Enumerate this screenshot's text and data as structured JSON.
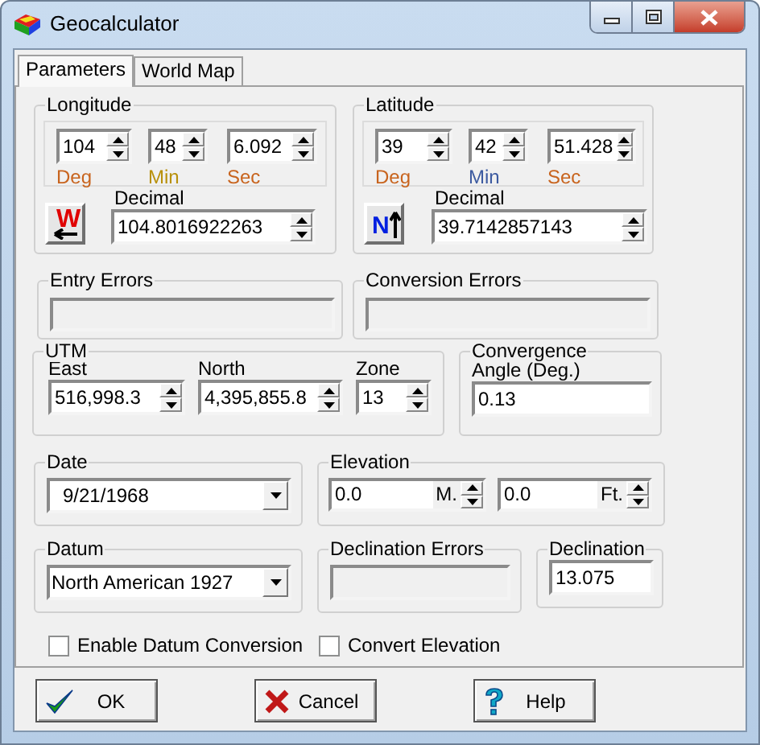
{
  "window": {
    "title": "Geocalculator"
  },
  "tabs": [
    {
      "label": "Parameters",
      "selected": true
    },
    {
      "label": "World Map",
      "selected": false
    }
  ],
  "longitude": {
    "label": "Longitude",
    "fields": [
      {
        "label": "Deg",
        "value": "104"
      },
      {
        "label": "Min",
        "value": "48"
      },
      {
        "label": "Sec",
        "value": "6.092"
      }
    ],
    "hemisphere": "W",
    "decimal_label": "Decimal",
    "decimal": "104.8016922263"
  },
  "latitude": {
    "label": "Latitude",
    "fields": [
      {
        "label": "Deg",
        "value": "39"
      },
      {
        "label": "Min",
        "value": "42"
      },
      {
        "label": "Sec",
        "value": "51.428"
      }
    ],
    "hemisphere": "N",
    "decimal_label": "Decimal",
    "decimal": "39.7142857143"
  },
  "entry_errors": {
    "label": "Entry Errors"
  },
  "conversion_errors": {
    "label": "Conversion Errors"
  },
  "utm": {
    "label": "UTM",
    "fields": [
      {
        "label": "East",
        "value": "516,998.3"
      },
      {
        "label": "North",
        "value": "4,395,855.8"
      },
      {
        "label": "Zone",
        "value": "13"
      }
    ]
  },
  "convergence": {
    "label": "Convergence",
    "sublabel": "Angle (Deg.)",
    "value": "0.13"
  },
  "date": {
    "label": "Date",
    "value": "9/21/1968"
  },
  "elevation": {
    "label": "Elevation",
    "fields": [
      {
        "value": "0.0",
        "unit": "M."
      },
      {
        "value": "0.0",
        "unit": "Ft."
      }
    ]
  },
  "datum": {
    "label": "Datum",
    "value": "North American 1927"
  },
  "declination_errors": {
    "label": "Declination Errors"
  },
  "declination": {
    "label": "Declination",
    "value": "13.075"
  },
  "checkboxes": [
    {
      "label": "Enable Datum Conversion",
      "checked": false
    },
    {
      "label": "Convert Elevation",
      "checked": false
    }
  ],
  "buttons": [
    {
      "label": "OK",
      "kind": "ok"
    },
    {
      "label": "Cancel",
      "kind": "cancel"
    },
    {
      "label": "Help",
      "kind": "help"
    }
  ]
}
